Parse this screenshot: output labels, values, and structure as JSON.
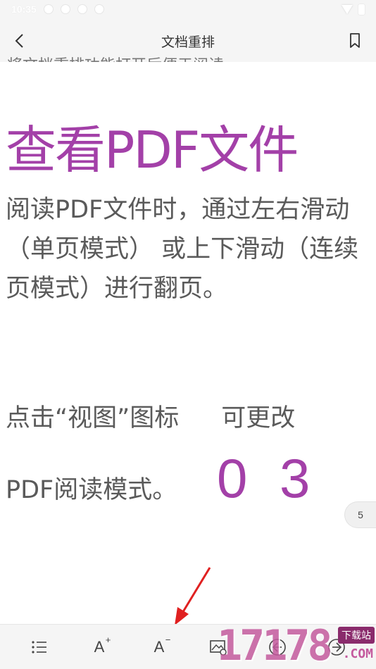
{
  "status_bar": {
    "time": "10:35"
  },
  "app_bar": {
    "title": "文档重排",
    "back_icon": "chevron-left-icon",
    "bookmark_icon": "bookmark-icon"
  },
  "content": {
    "clipped_line": "将文档重排功能打开后便于阅读",
    "heading": "查看PDF文件",
    "paragraph1": "阅读PDF文件时，通过左右滑动（单页模式） 或上下滑动（连续页模式）进行翻页。",
    "paragraph2_part1": "点击“视图”图标",
    "paragraph2_part2": "可更改",
    "paragraph3": "PDF阅读模式。",
    "step_number": "0 3"
  },
  "page_indicator": "5",
  "toolbar": {
    "items": [
      {
        "icon": "list-icon"
      },
      {
        "label": "A",
        "sup": "+"
      },
      {
        "label": "A",
        "sup": "−"
      },
      {
        "icon": "image-settings-icon"
      },
      {
        "icon": "arrow-left-circle-icon"
      },
      {
        "icon": "arrow-right-circle-icon"
      }
    ]
  },
  "watermark": {
    "digits": "17178",
    "badge": "下载站",
    "suffix": ".COM"
  },
  "colors": {
    "accent": "#a340a8",
    "annotation_arrow": "#e02020",
    "bar_bg": "#f5f5f5"
  }
}
